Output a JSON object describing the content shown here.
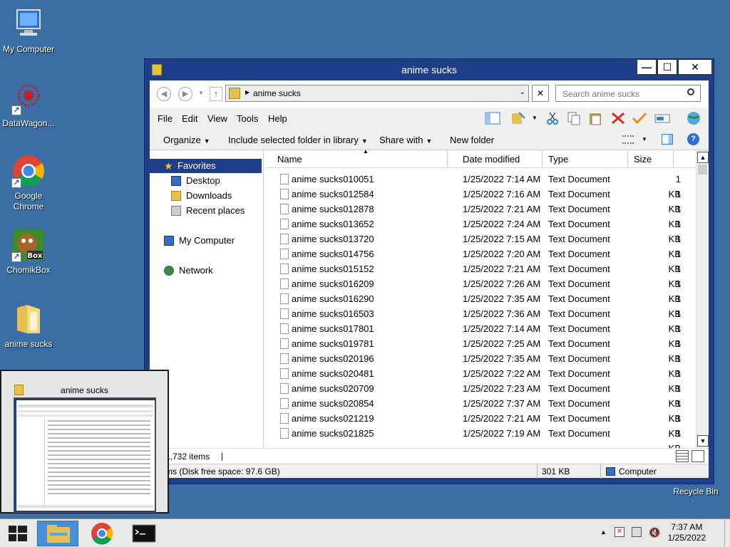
{
  "desktop": {
    "icons": [
      {
        "label": "My Computer"
      },
      {
        "label": "DataWagon..."
      },
      {
        "label": "Google Chrome"
      },
      {
        "label": "ChomikBox"
      },
      {
        "label": "anime sucks"
      }
    ],
    "recycle_bin": "Recycle Bin"
  },
  "window": {
    "title": "anime sucks",
    "controls": {
      "minimize": "—",
      "maximize": "☐",
      "close": "✕"
    },
    "address": {
      "segment": "anime sucks"
    },
    "search_placeholder": "Search anime sucks",
    "menu": [
      "File",
      "Edit",
      "View",
      "Tools",
      "Help"
    ],
    "commands": [
      "Organize",
      "Include selected folder in library",
      "Share with",
      "New folder"
    ],
    "nav_pane": {
      "favorites": "Favorites",
      "desktop": "Desktop",
      "downloads": "Downloads",
      "recent": "Recent places",
      "computer": "My Computer",
      "network": "Network"
    },
    "columns": {
      "name": "Name",
      "date": "Date modified",
      "type": "Type",
      "size": "Size"
    },
    "files": [
      {
        "name": "anime sucks010051",
        "date": "1/25/2022 7:14 AM",
        "type": "Text Document",
        "size": "1 KB"
      },
      {
        "name": "anime sucks012584",
        "date": "1/25/2022 7:16 AM",
        "type": "Text Document",
        "size": "1 KB"
      },
      {
        "name": "anime sucks012878",
        "date": "1/25/2022 7:21 AM",
        "type": "Text Document",
        "size": "1 KB"
      },
      {
        "name": "anime sucks013652",
        "date": "1/25/2022 7:24 AM",
        "type": "Text Document",
        "size": "1 KB"
      },
      {
        "name": "anime sucks013720",
        "date": "1/25/2022 7:15 AM",
        "type": "Text Document",
        "size": "1 KB"
      },
      {
        "name": "anime sucks014756",
        "date": "1/25/2022 7:20 AM",
        "type": "Text Document",
        "size": "1 KB"
      },
      {
        "name": "anime sucks015152",
        "date": "1/25/2022 7:21 AM",
        "type": "Text Document",
        "size": "1 KB"
      },
      {
        "name": "anime sucks016209",
        "date": "1/25/2022 7:26 AM",
        "type": "Text Document",
        "size": "1 KB"
      },
      {
        "name": "anime sucks016290",
        "date": "1/25/2022 7:35 AM",
        "type": "Text Document",
        "size": "1 KB"
      },
      {
        "name": "anime sucks016503",
        "date": "1/25/2022 7:36 AM",
        "type": "Text Document",
        "size": "1 KB"
      },
      {
        "name": "anime sucks017801",
        "date": "1/25/2022 7:14 AM",
        "type": "Text Document",
        "size": "1 KB"
      },
      {
        "name": "anime sucks019781",
        "date": "1/25/2022 7:25 AM",
        "type": "Text Document",
        "size": "1 KB"
      },
      {
        "name": "anime sucks020196",
        "date": "1/25/2022 7:35 AM",
        "type": "Text Document",
        "size": "1 KB"
      },
      {
        "name": "anime sucks020481",
        "date": "1/25/2022 7:22 AM",
        "type": "Text Document",
        "size": "1 KB"
      },
      {
        "name": "anime sucks020709",
        "date": "1/25/2022 7:23 AM",
        "type": "Text Document",
        "size": "1 KB"
      },
      {
        "name": "anime sucks020854",
        "date": "1/25/2022 7:37 AM",
        "type": "Text Document",
        "size": "1 KB"
      },
      {
        "name": "anime sucks021219",
        "date": "1/25/2022 7:21 AM",
        "type": "Text Document",
        "size": "1 KB"
      },
      {
        "name": "anime sucks021825",
        "date": "1/25/2022 7:19 AM",
        "type": "Text Document",
        "size": "1 KB"
      }
    ],
    "status": {
      "item_count": "1,732 items",
      "disk_free": "ms (Disk free space: 97.6 GB)",
      "total_size": "301 KB",
      "location": "Computer"
    }
  },
  "preview": {
    "title": "anime sucks"
  },
  "taskbar": {
    "time": "7:37 AM",
    "date": "1/25/2022"
  }
}
